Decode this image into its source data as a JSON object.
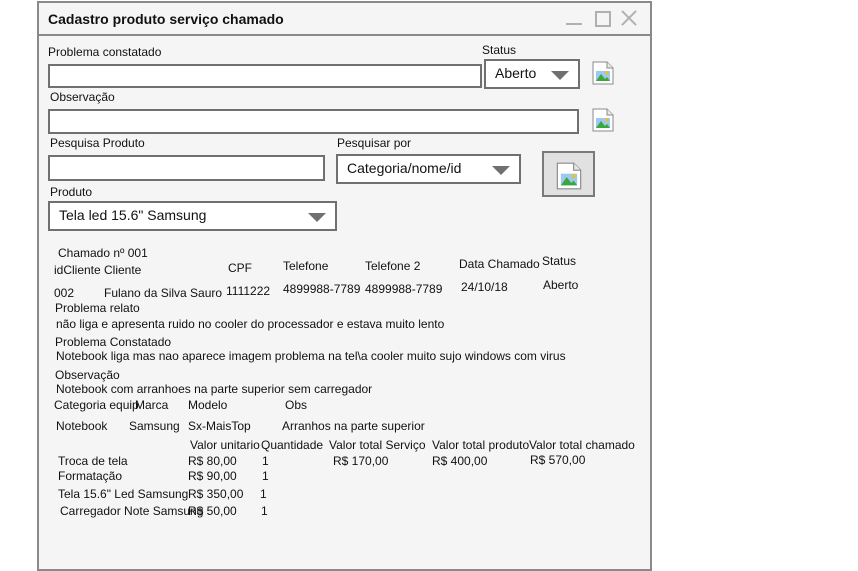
{
  "window": {
    "title": "Cadastro produto serviço chamado"
  },
  "form": {
    "problema_label": "Problema constatado",
    "problema_value": "",
    "status_label": "Status",
    "status_value": "Aberto",
    "observacao_label": "Observação",
    "observacao_value": "",
    "pesquisa_label": "Pesquisa Produto",
    "pesquisa_value": "",
    "pesquisar_por_label": "Pesquisar por",
    "pesquisar_por_value": "Categoria/nome/id",
    "produto_label": "Produto",
    "produto_value": "Tela led 15.6\" Samsung"
  },
  "icons": {
    "image": "broken-image-icon",
    "minimize": "minimize-icon",
    "maximize": "maximize-icon",
    "close": "close-icon"
  },
  "report": {
    "chamado": "Chamado nº 001",
    "headers": {
      "idcliente": "idCliente",
      "cliente": "Cliente",
      "cpf": "CPF",
      "telefone": "Telefone",
      "telefone2": "Telefone 2",
      "data": "Data Chamado",
      "status": "Status"
    },
    "row": {
      "idcliente": "002",
      "cliente": "Fulano da Silva Sauro",
      "cpf": "1111222",
      "telefone": "4899988-7789",
      "telefone2": "4899988-7789",
      "data": "24/10/18",
      "status": "Aberto"
    },
    "problema_relato_label": "Problema relato",
    "problema_relato": "não liga e apresenta ruido no cooler do processador e estava muito lento",
    "problema_constatado_label": "Problema Constatado",
    "problema_constatado": "Notebook liga mas nao aparece imagem problema na tel\\a cooler muito sujo windows com virus",
    "observacao_label": "Observação",
    "observacao": "Notebook com arranhoes na parte superior sem carregador",
    "equip_headers": {
      "categoria": "Categoria equip",
      "marca": "Marca",
      "modelo": "Modelo",
      "obs": "Obs"
    },
    "equip_row": {
      "categoria": "Notebook",
      "marca": "Samsung",
      "modelo": "Sx-MaisTop",
      "obs": "Arranhos na parte superior"
    },
    "item_headers": {
      "valor_unitario": "Valor unitario",
      "quantidade": "Quantidade",
      "total_servico": "Valor total Serviço",
      "total_produto": "Valor total produto",
      "total_chamado": "Valor total chamado"
    },
    "items": [
      {
        "nome": "Troca de tela",
        "valor": "R$ 80,00",
        "qtd": "1"
      },
      {
        "nome": "Formatação",
        "valor": "R$ 90,00",
        "qtd": "1"
      },
      {
        "nome": "Tela 15.6\" Led Samsung",
        "valor": "R$ 350,00",
        "qtd": "1"
      },
      {
        "nome": "Carregador Note Samsung",
        "valor": "R$ 50,00",
        "qtd": "1"
      }
    ],
    "totals": {
      "servico": "R$ 170,00",
      "produto": "R$ 400,00",
      "chamado": "R$ 570,00"
    }
  }
}
